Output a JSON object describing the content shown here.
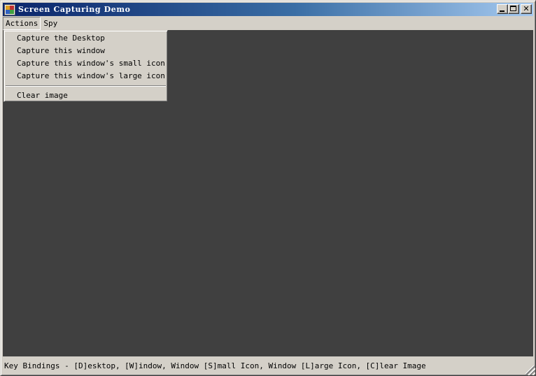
{
  "window": {
    "title": "Screen Capturing Demo",
    "app_icon": "app-window-icon"
  },
  "caption_buttons": {
    "minimize_icon": "minimize-icon",
    "maximize_icon": "maximize-icon",
    "close_glyph": "✕"
  },
  "menubar": {
    "items": [
      {
        "label": "Actions"
      },
      {
        "label": "Spy"
      }
    ]
  },
  "actions_menu": {
    "items": [
      {
        "label": "Capture the Desktop"
      },
      {
        "label": "Capture this window"
      },
      {
        "label": "Capture this window's small icon"
      },
      {
        "label": "Capture this window's large icon"
      },
      {
        "label": "Clear image"
      }
    ]
  },
  "statusbar": {
    "text": "Key Bindings - [D]esktop, [W]indow, Window [S]mall Icon, Window [L]arge Icon, [C]lear Image"
  },
  "colors": {
    "client_background": "#404040",
    "title_gradient_start": "#0a246a",
    "title_gradient_end": "#a6caf0",
    "chrome": "#d4d0c8"
  }
}
